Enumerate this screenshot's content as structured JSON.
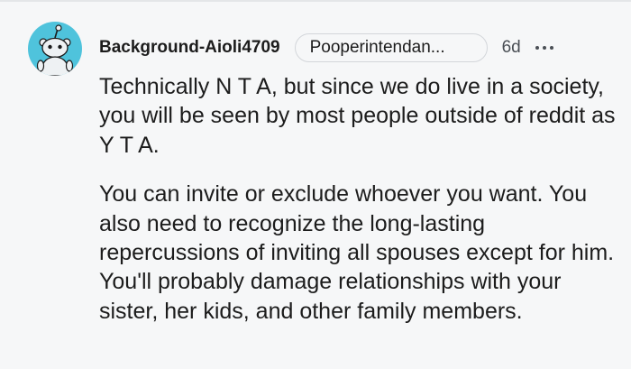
{
  "comment": {
    "username": "Background-Aioli4709",
    "flair": "Pooperintendan...",
    "age": "6d",
    "more_icon": "more-dots-icon",
    "avatar_icon": "reddit-snoo-avatar",
    "paragraphs": [
      "Technically N T A, but since we do live in a society, you will be seen by most people outside of reddit as Y T A.",
      "You can invite or exclude whoever you want. You also need to recognize the long-lasting repercussions of inviting all spouses except for him. You'll probably damage relationships with your sister, her kids, and other family members."
    ]
  },
  "colors": {
    "background": "#f6f7f8",
    "avatar_bg": "#4fc3dc",
    "text": "#1c1c1c",
    "meta": "#4a4f55"
  }
}
